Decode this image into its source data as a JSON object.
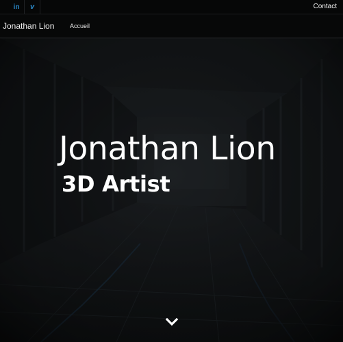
{
  "topbar": {
    "social": [
      {
        "icon": "linkedin-icon",
        "glyph": "in"
      },
      {
        "icon": "vimeo-icon",
        "glyph": "v"
      }
    ],
    "contact_label": "Contact"
  },
  "navbar": {
    "brand": "Jonathan Lion",
    "items": [
      "Accueil"
    ]
  },
  "hero": {
    "title": "Jonathan Lion",
    "subtitle": "3D Artist",
    "scroll_icon": "chevron-down-icon"
  },
  "colors": {
    "social_accent": "#2a88c7",
    "bar_background": "#060707",
    "text": "#ffffff"
  }
}
